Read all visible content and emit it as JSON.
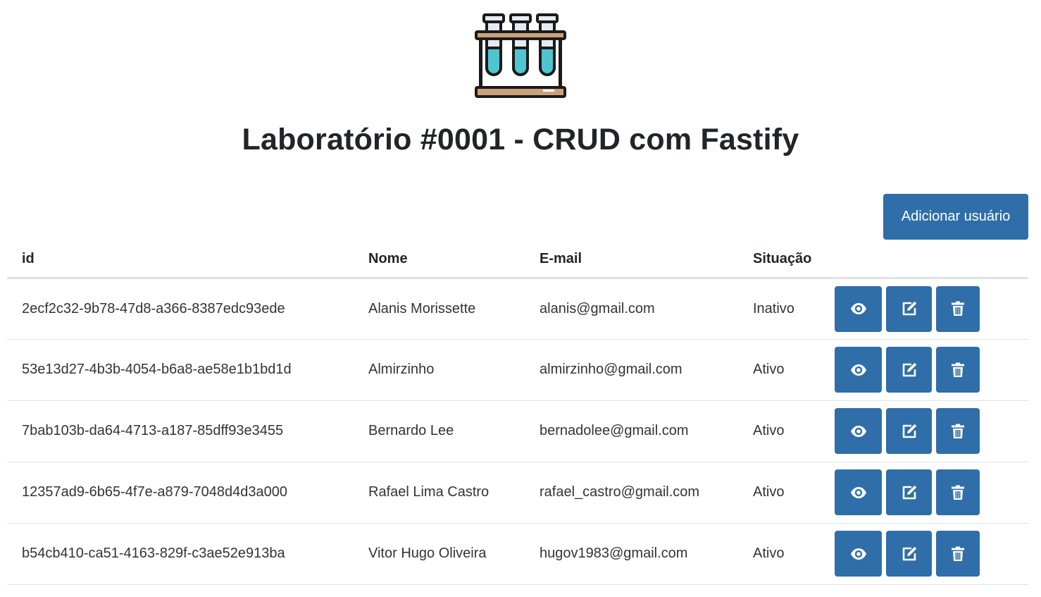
{
  "page": {
    "title": "Laboratório #0001 - CRUD com Fastify",
    "logo_icon": "test-tubes-icon"
  },
  "toolbar": {
    "add_label": "Adicionar usuário"
  },
  "table": {
    "headers": {
      "id": "id",
      "name": "Nome",
      "email": "E-mail",
      "status": "Situação"
    },
    "rows": [
      {
        "id": "2ecf2c32-9b78-47d8-a366-8387edc93ede",
        "name": "Alanis Morissette",
        "email": "alanis@gmail.com",
        "status": "Inativo"
      },
      {
        "id": "53e13d27-4b3b-4054-b6a8-ae58e1b1bd1d",
        "name": "Almirzinho",
        "email": "almirzinho@gmail.com",
        "status": "Ativo"
      },
      {
        "id": "7bab103b-da64-4713-a187-85dff93e3455",
        "name": "Bernardo Lee",
        "email": "bernadolee@gmail.com",
        "status": "Ativo"
      },
      {
        "id": "12357ad9-6b65-4f7e-a879-7048d4d3a000",
        "name": "Rafael Lima Castro",
        "email": "rafael_castro@gmail.com",
        "status": "Ativo"
      },
      {
        "id": "b54cb410-ca51-4163-829f-c3ae52e913ba",
        "name": "Vitor Hugo Oliveira",
        "email": "hugov1983@gmail.com",
        "status": "Ativo"
      }
    ],
    "action_icons": [
      "eye-icon",
      "edit-icon",
      "trash-icon"
    ]
  },
  "colors": {
    "accent": "#2f6ea8",
    "text": "#212529",
    "border": "#dee2e6",
    "tube_liquid": "#4fc6cf",
    "rack_wood": "#c9a27a"
  }
}
